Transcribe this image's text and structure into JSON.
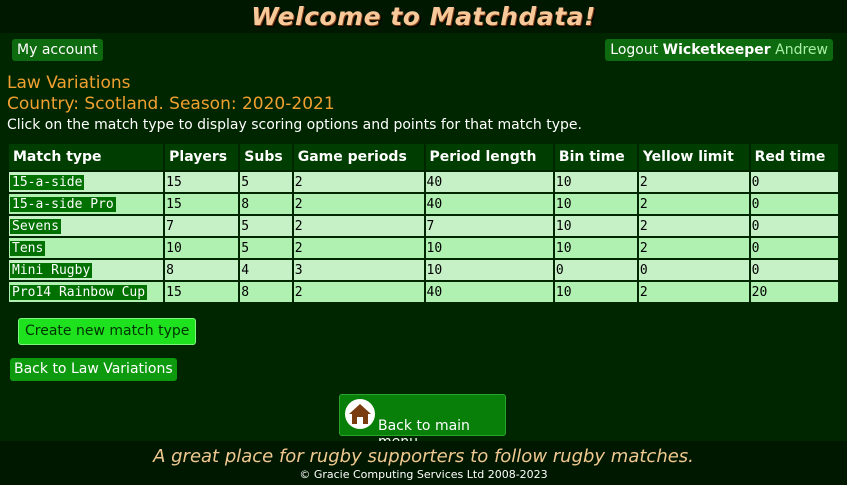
{
  "header": {
    "title": "Welcome to Matchdata!"
  },
  "nav": {
    "my_account": "My account",
    "logout_label": "Logout",
    "user_role": "Wicketkeeper",
    "user_name": "Andrew"
  },
  "page": {
    "title": "Law Variations",
    "subtitle": "Country: Scotland. Season: 2020-2021",
    "instructions": "Click on the match type to display scoring options and points for that match type."
  },
  "table": {
    "columns": [
      "Match type",
      "Players",
      "Subs",
      "Game periods",
      "Period length",
      "Bin time",
      "Yellow limit",
      "Red time"
    ],
    "rows": [
      [
        "15-a-side",
        "15",
        "5",
        "2",
        "40",
        "10",
        "2",
        "0"
      ],
      [
        "15-a-side Pro",
        "15",
        "8",
        "2",
        "40",
        "10",
        "2",
        "0"
      ],
      [
        "Sevens",
        "7",
        "5",
        "2",
        "7",
        "10",
        "2",
        "0"
      ],
      [
        "Tens",
        "10",
        "5",
        "2",
        "10",
        "10",
        "2",
        "0"
      ],
      [
        "Mini Rugby",
        "8",
        "4",
        "3",
        "10",
        "0",
        "0",
        "0"
      ],
      [
        "Pro14 Rainbow Cup",
        "15",
        "8",
        "2",
        "40",
        "10",
        "2",
        "20"
      ]
    ]
  },
  "actions": {
    "create": "Create new match type",
    "back_law": "Back to Law Variations",
    "main_menu": "Back to main menu"
  },
  "icons": {
    "main_menu_icon": "home-icon"
  },
  "colors": {
    "background": "#002600",
    "accent_orange": "#f0a030",
    "button_green": "#0e6a0e",
    "row_light": "#c6f0c6",
    "row_alt": "#b0f0b0",
    "create_button": "#1ee21e"
  },
  "footer": {
    "tagline": "A great place for rugby supporters to follow rugby matches.",
    "copyright": "© Gracie Computing Services Ltd 2008-2023"
  }
}
